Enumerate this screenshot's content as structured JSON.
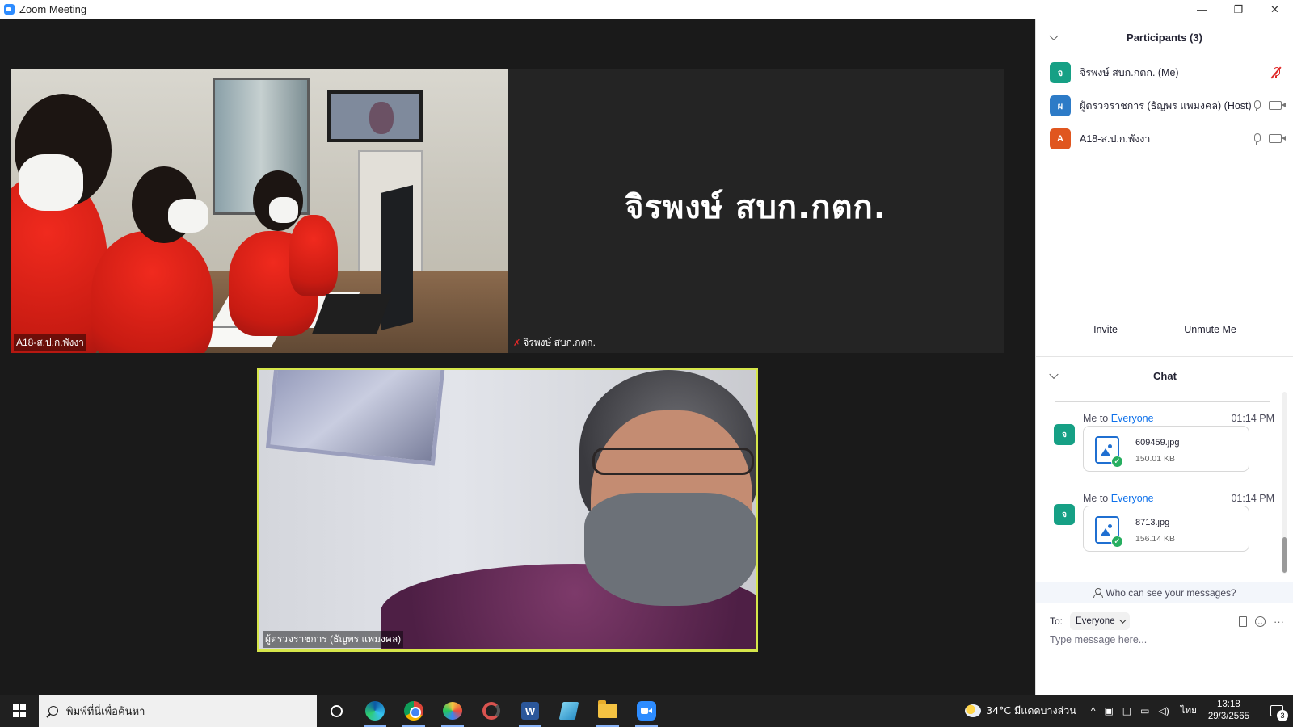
{
  "window": {
    "title": "Zoom Meeting",
    "minimize": "—",
    "restore": "❐",
    "close": "✕"
  },
  "video": {
    "tiles": [
      {
        "label": "A18-ส.ป.ก.พังงา"
      },
      {
        "label": "จิรพงษ์ สบก.กตก.",
        "display_name": "จิรพงษ์ สบก.กตก."
      },
      {
        "label": "ผู้ตรวจราชการ (ธัญพร แพมงคล)"
      }
    ],
    "active_border_color": "#d6e64a"
  },
  "participants": {
    "title": "Participants (3)",
    "list": [
      {
        "initial": "จ",
        "name": "จิรพงษ์ สบก.กตก. (Me)",
        "avatar_color": "#16a085",
        "mic": "muted",
        "video": "none"
      },
      {
        "initial": "ผ",
        "name": "ผู้ตรวจราชการ (ธัญพร แพมงคล) (Host)",
        "avatar_color": "#2d7bc7",
        "mic": "on",
        "video": "off"
      },
      {
        "initial": "A",
        "name": "A18-ส.ป.ก.พังงา",
        "avatar_color": "#e0561f",
        "mic": "on",
        "video": "off"
      }
    ],
    "invite_label": "Invite",
    "unmute_label": "Unmute Me"
  },
  "chat": {
    "title": "Chat",
    "messages": [
      {
        "avatar_initial": "จ",
        "sender": "Me to ",
        "recipient": "Everyone",
        "time": "01:14 PM",
        "file_name": "609459.jpg",
        "file_size": "150.01 KB"
      },
      {
        "avatar_initial": "จ",
        "sender": "Me to ",
        "recipient": "Everyone",
        "time": "01:14 PM",
        "file_name": "8713.jpg",
        "file_size": "156.14 KB"
      }
    ],
    "privacy_text": "Who can see your messages?",
    "to_label": "To:",
    "to_value": "Everyone",
    "more_label": "···",
    "input_placeholder": "Type message here..."
  },
  "taskbar": {
    "search_placeholder": "พิมพ์ที่นี่เพื่อค้นหา",
    "word_letter": "W",
    "weather": "34°C  มีแดดบางส่วน",
    "language": "ไทย",
    "time": "13:18",
    "date": "29/3/2565",
    "notification_count": "3",
    "tray_chevron": "^"
  }
}
